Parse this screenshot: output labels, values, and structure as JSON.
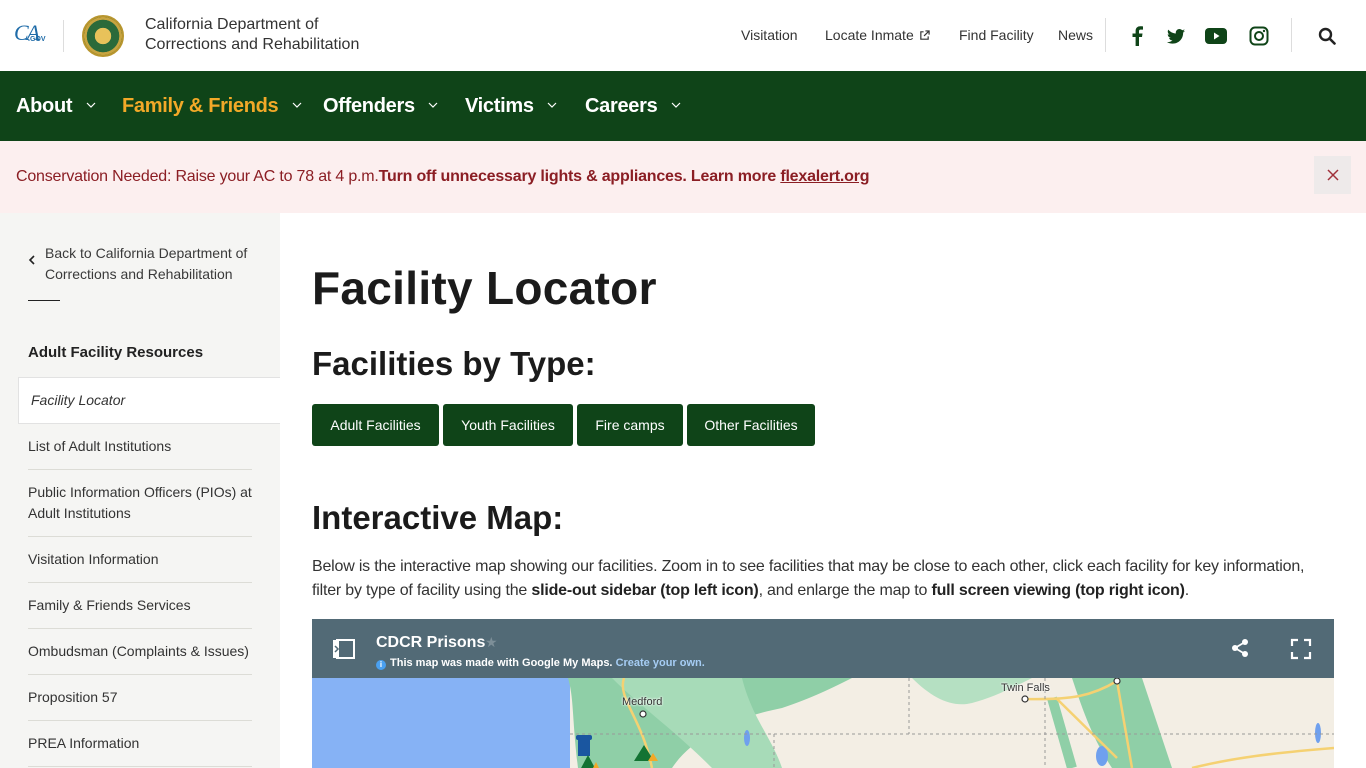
{
  "header": {
    "ca_logo_text": "CA",
    "ca_logo_suffix": ".GOV",
    "org_name_line1": "California Department of",
    "org_name_line2": "Corrections and Rehabilitation",
    "utility_links": [
      {
        "label": "Visitation"
      },
      {
        "label": "Locate Inmate",
        "icon": "external-link-icon"
      },
      {
        "label": "Find Facility"
      },
      {
        "label": "News"
      }
    ],
    "social": [
      "facebook-icon",
      "twitter-icon",
      "youtube-icon",
      "instagram-icon"
    ],
    "search_icon": "search-icon"
  },
  "nav": {
    "items": [
      {
        "label": "About",
        "active": false
      },
      {
        "label": "Family & Friends",
        "active": true
      },
      {
        "label": "Offenders",
        "active": false
      },
      {
        "label": "Victims",
        "active": false
      },
      {
        "label": "Careers",
        "active": false
      }
    ]
  },
  "alert": {
    "plain": "Conservation Needed: Raise your AC to 78 at 4 p.m.",
    "bold": "Turn off unnecessary lights & appliances. Learn more ",
    "link": "flexalert.org",
    "close_icon": "close-icon"
  },
  "sidebar": {
    "back_line1": "Back to California Department of",
    "back_line2": "Corrections and Rehabilitation",
    "heading": "Adult Facility Resources",
    "current": "Facility Locator",
    "items": [
      {
        "label": "List of Adult Institutions"
      },
      {
        "label": "Public Information Officers (PIOs) at Adult Institutions"
      },
      {
        "label": "Visitation Information"
      },
      {
        "label": "Family & Friends Services"
      },
      {
        "label": "Ombudsman (Complaints & Issues)"
      },
      {
        "label": "Proposition 57"
      },
      {
        "label": "PREA Information"
      }
    ]
  },
  "content": {
    "title": "Facility Locator",
    "types_heading": "Facilities by Type:",
    "type_buttons": [
      {
        "label": "Adult Facilities"
      },
      {
        "label": "Youth Facilities"
      },
      {
        "label": "Fire camps"
      },
      {
        "label": "Other Facilities"
      }
    ],
    "map_heading": "Interactive Map:",
    "intro_1": "Below is the interactive map showing our facilities. Zoom in to see facilities that may be close to each other, click each facility for key information, filter by type of facility using the ",
    "intro_bold_1": "slide-out sidebar (top left icon)",
    "intro_2": ", and enlarge the map to ",
    "intro_bold_2": "full screen viewing (top right icon)",
    "intro_3": "."
  },
  "map": {
    "title": "CDCR Prisons",
    "note": "This map was made with Google My Maps.",
    "create_link": "Create your own.",
    "labels": {
      "medford": "Medford",
      "twin_falls": "Twin Falls"
    }
  },
  "colors": {
    "brand_green": "#0f4418",
    "accent_gold": "#f2a928",
    "alert_bg": "#fcefef",
    "alert_text": "#8b1e24",
    "map_bar": "#526a76"
  }
}
